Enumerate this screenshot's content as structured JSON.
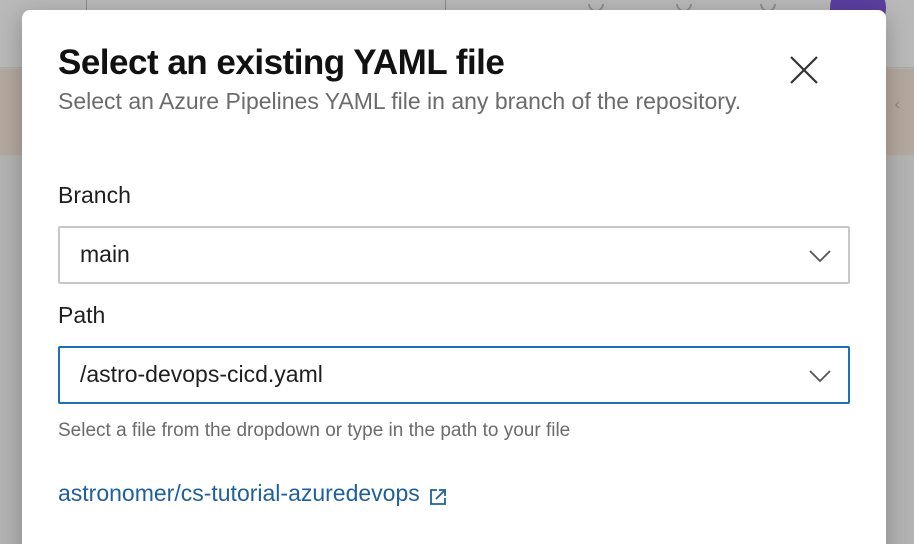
{
  "dialog": {
    "title": "Select an existing YAML file",
    "subtitle": "Select an Azure Pipelines YAML file in any branch of the repository.",
    "close_icon": "close-icon"
  },
  "branch": {
    "label": "Branch",
    "value": "main",
    "icon": "chevron-down-icon"
  },
  "path": {
    "label": "Path",
    "value": "/astro-devops-cicd.yaml",
    "icon": "chevron-down-icon",
    "helper": "Select a file from the dropdown or type in the path to your file"
  },
  "repo_link": {
    "text": "astronomer/cs-tutorial-azuredevops",
    "icon": "external-link-icon"
  },
  "colors": {
    "accent": "#1d6fb8",
    "link": "#1f5f9e",
    "title": "#111111",
    "muted": "#6b6b6b",
    "avatar": "#5b3fa0"
  }
}
